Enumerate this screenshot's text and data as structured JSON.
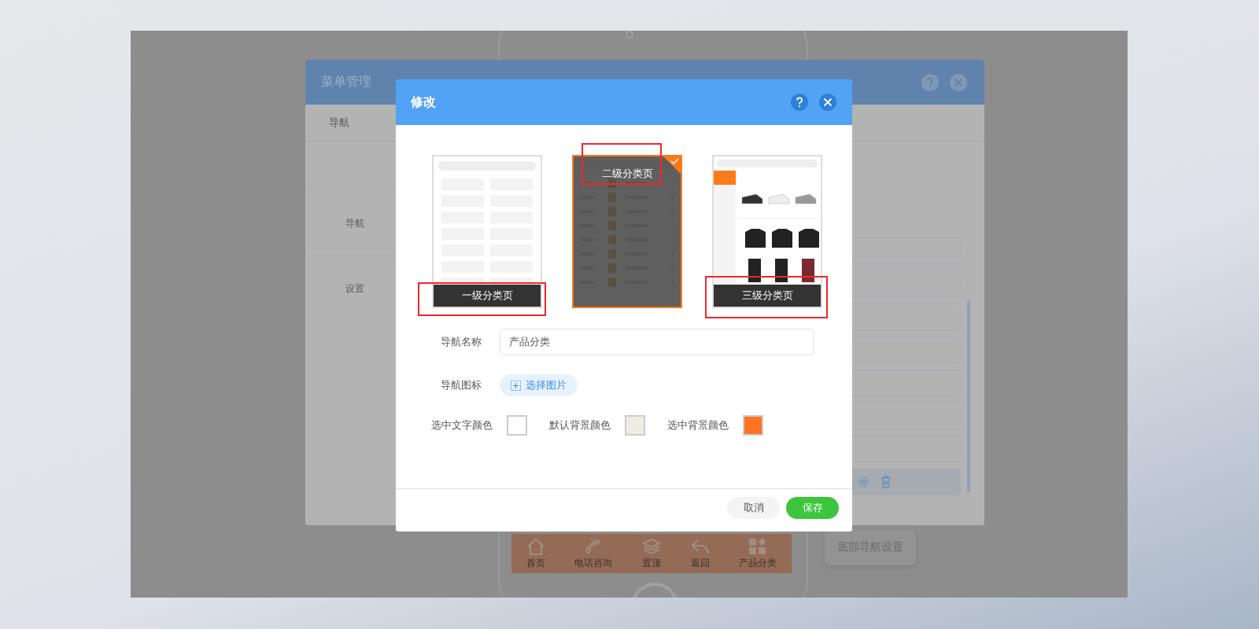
{
  "menu_window": {
    "title": "菜单管理",
    "tabs": [
      {
        "label": "导航"
      }
    ],
    "side_labels": [
      "导航",
      "设置"
    ]
  },
  "bottom_nav": [
    {
      "label": "首页",
      "kind": "home"
    },
    {
      "label": "电话咨询",
      "kind": "phone"
    },
    {
      "label": "置顶",
      "kind": "layers"
    },
    {
      "label": "返回",
      "kind": "back"
    },
    {
      "label": "产品分类",
      "kind": "category"
    }
  ],
  "bottom_nav_settings": "底部导航设置",
  "dialog": {
    "title": "修改",
    "templates": [
      {
        "label": "一级分类页",
        "kind": "grid",
        "selected": false
      },
      {
        "label": "二级分类页",
        "kind": "list",
        "selected": true
      },
      {
        "label": "三级分类页",
        "kind": "gallery",
        "selected": false
      }
    ],
    "name_label": "导航名称",
    "name_value": "产品分类",
    "icon_label": "导航图标",
    "icon_button": "选择图片",
    "colors": [
      {
        "label": "选中文字颜色",
        "color": "#ffffff"
      },
      {
        "label": "默认背景颜色",
        "color": "#eeede3"
      },
      {
        "label": "选中背景颜色",
        "color": "#ff7324"
      }
    ],
    "cancel": "取消",
    "save": "保存"
  }
}
